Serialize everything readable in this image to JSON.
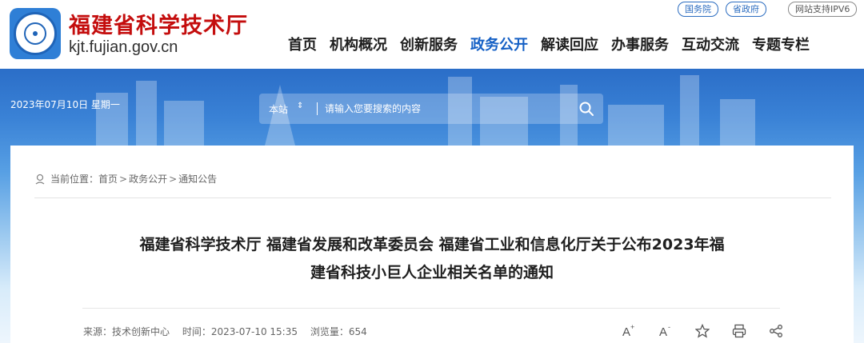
{
  "header": {
    "site_name": "福建省科学技术厅",
    "domain": "kjt.fujian.gov.cn",
    "links": [
      "国务院",
      "省政府"
    ],
    "ipv6": "网站支持IPV6"
  },
  "nav": {
    "items": [
      {
        "label": "首页",
        "active": false
      },
      {
        "label": "机构概况",
        "active": false
      },
      {
        "label": "创新服务",
        "active": false
      },
      {
        "label": "政务公开",
        "active": true
      },
      {
        "label": "解读回应",
        "active": false
      },
      {
        "label": "办事服务",
        "active": false
      },
      {
        "label": "互动交流",
        "active": false
      },
      {
        "label": "专题专栏",
        "active": false
      }
    ],
    "active_color": "#1560c5"
  },
  "banner": {
    "date": "2023年07月10日 星期一"
  },
  "search": {
    "scope": "本站",
    "placeholder": "请输入您要搜索的内容"
  },
  "breadcrumb": {
    "label": "当前位置：",
    "items": [
      "首页",
      "政务公开",
      "通知公告"
    ],
    "separator": ">"
  },
  "article": {
    "title_line1": "福建省科学技术厅 福建省发展和改革委员会 福建省工业和信息化厅关于公布2023年福",
    "title_line2": "建省科技小巨人企业相关名单的通知",
    "source": "来源：技术创新中心",
    "time": "时间：2023-07-10 15:35",
    "views": "浏览量：654"
  },
  "tools": [
    "font-increase-icon",
    "font-decrease-icon",
    "favorite-star-icon",
    "print-icon",
    "share-icon"
  ],
  "colors": {
    "brand_red": "#c40d0d",
    "link_blue": "#2b6cc0",
    "banner_top": "#2b6ec8"
  }
}
